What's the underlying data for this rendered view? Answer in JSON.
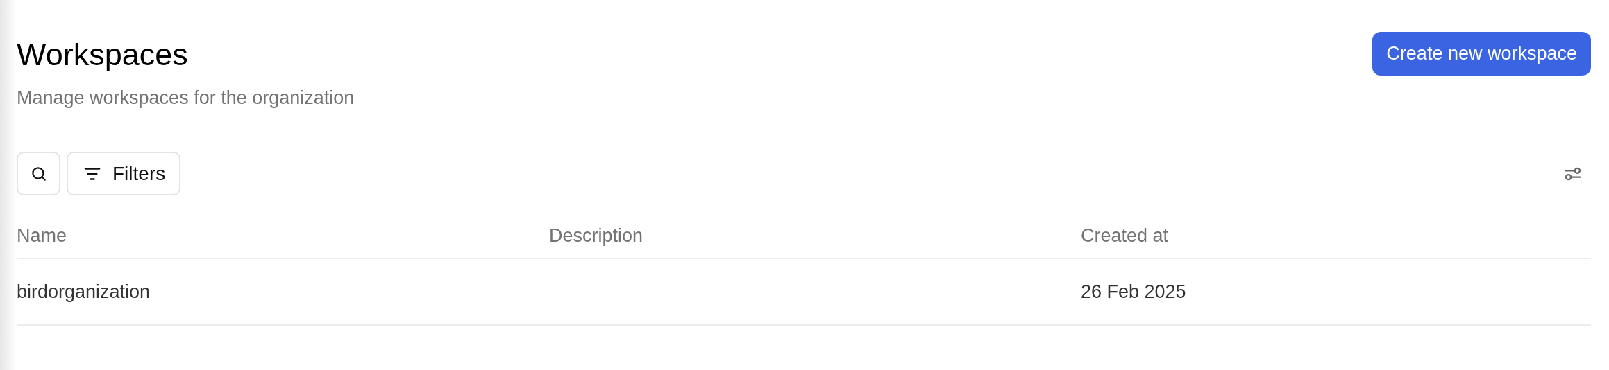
{
  "page": {
    "title": "Workspaces",
    "subtitle": "Manage workspaces for the organization"
  },
  "primary_button": {
    "label": "Create new workspace"
  },
  "toolbar": {
    "filters_button": {
      "label": "Filters"
    }
  },
  "table": {
    "columns": [
      "Name",
      "Description",
      "Created at"
    ],
    "rows": [
      {
        "name": "birdorganization",
        "created_at": "26 Feb 2025"
      }
    ]
  }
}
